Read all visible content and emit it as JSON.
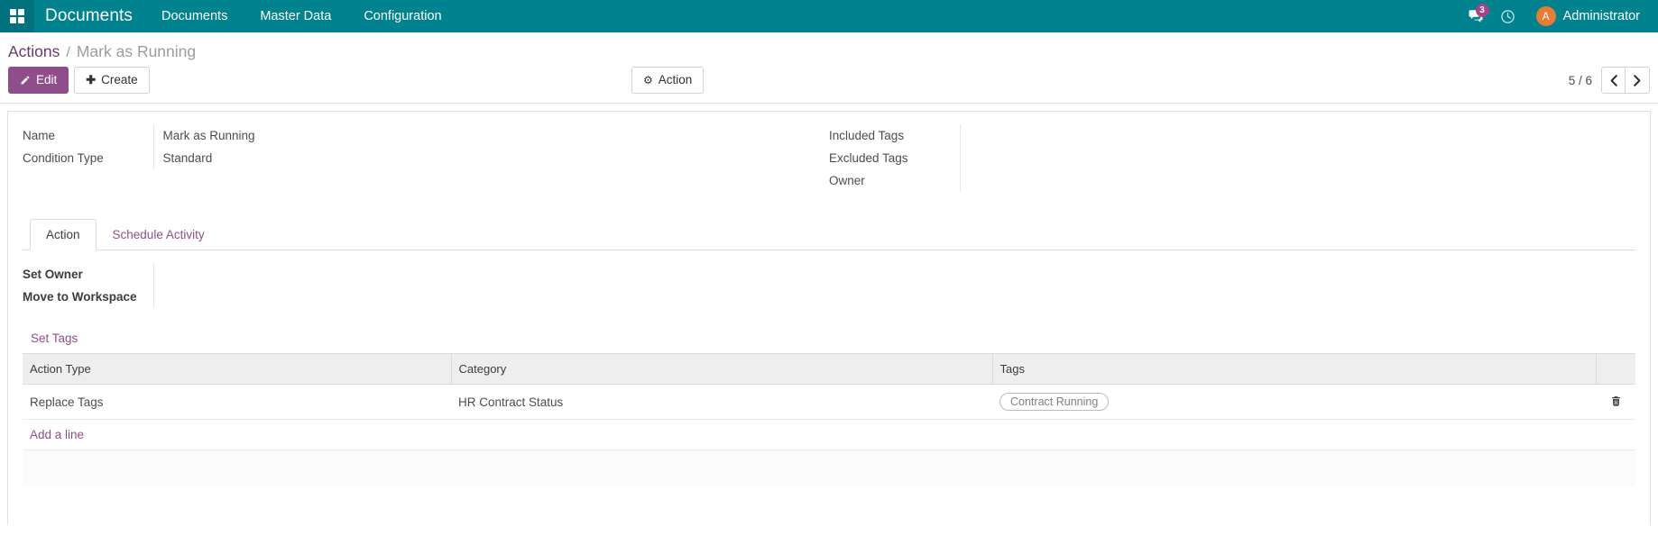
{
  "navbar": {
    "apps_icon": "apps-grid-icon",
    "brand": "Documents",
    "menu": [
      {
        "label": "Documents"
      },
      {
        "label": "Master Data"
      },
      {
        "label": "Configuration"
      }
    ],
    "messages_icon": "messages-icon",
    "messages_count": "3",
    "activities_icon": "clock-icon",
    "avatar_initial": "A",
    "user_name": "Administrator",
    "bg_color": "#00838f",
    "badge_color": "#a24689",
    "avatar_color": "#e87b35"
  },
  "control_panel": {
    "breadcrumb": {
      "root": "Actions",
      "separator": "/",
      "current": "Mark as Running"
    },
    "edit_label": "Edit",
    "edit_icon": "pencil-icon",
    "create_label": "Create",
    "create_icon": "plus-icon",
    "action_label": "Action",
    "action_icon": "gear-icon",
    "pager_value": "5 / 6",
    "pager_prev_icon": "chevron-left-icon",
    "pager_next_icon": "chevron-right-icon",
    "accent_color": "#8f4e8b"
  },
  "form": {
    "left_fields": [
      {
        "label": "Name",
        "value": "Mark as Running"
      },
      {
        "label": "Condition Type",
        "value": "Standard"
      }
    ],
    "right_fields": [
      {
        "label": "Included Tags",
        "value": ""
      },
      {
        "label": "Excluded Tags",
        "value": ""
      },
      {
        "label": "Owner",
        "value": ""
      }
    ]
  },
  "notebook": {
    "tabs": [
      {
        "label": "Action",
        "active": true
      },
      {
        "label": "Schedule Activity",
        "active": false
      }
    ],
    "action_page": {
      "fields": [
        {
          "label": "Set Owner",
          "value": ""
        },
        {
          "label": "Move to Workspace",
          "value": ""
        }
      ],
      "section_title": "Set Tags",
      "table": {
        "headers": [
          "Action Type",
          "Category",
          "Tags"
        ],
        "rows": [
          {
            "action_type": "Replace Tags",
            "category": "HR Contract Status",
            "tags": [
              "Contract Running"
            ],
            "delete_icon": "trash-icon"
          }
        ],
        "add_line_label": "Add a line"
      }
    }
  }
}
